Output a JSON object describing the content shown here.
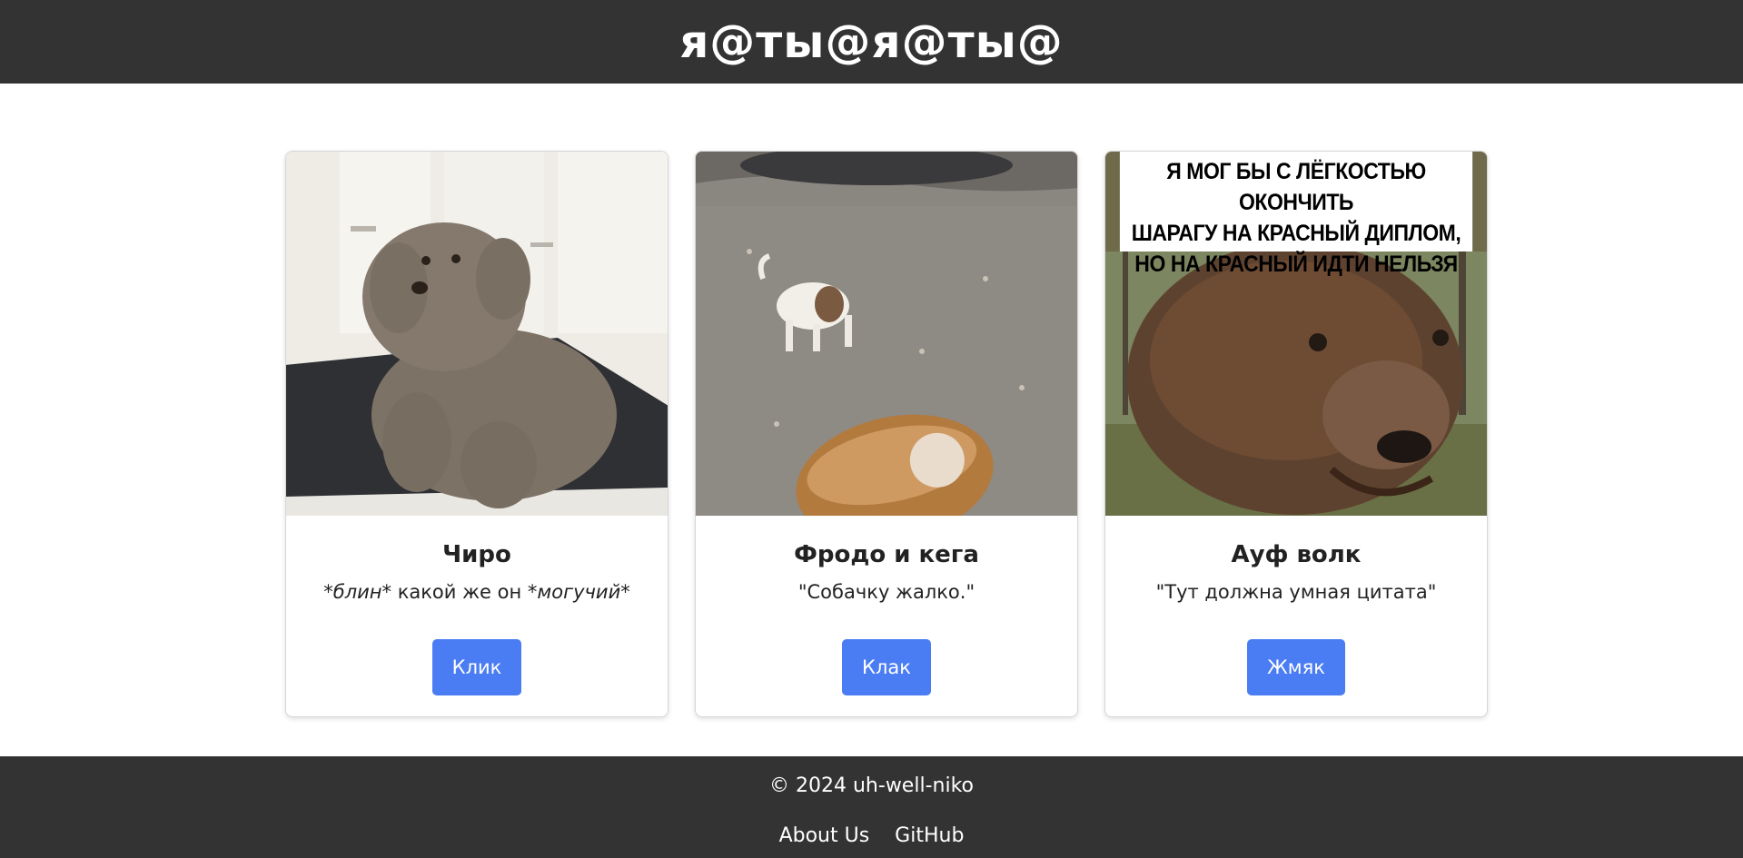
{
  "header": {
    "title": "я@ты@я@ты@"
  },
  "cards": [
    {
      "image_alt": "fluffy-grey-dog-photo",
      "title": "Чиро",
      "text_parts": [
        "*блин*",
        " какой же он ",
        "*могучий*"
      ],
      "button_label": "Клик"
    },
    {
      "image_alt": "dog-and-keg-photo",
      "title": "Фродо и кега",
      "text": "\"Собачку жалко.\"",
      "button_label": "Клак"
    },
    {
      "image_alt": "wolf-meme-photo",
      "image_caption": [
        "Я МОГ БЫ С ЛЁГКОСТЬЮ ОКОНЧИТЬ",
        "ШАРАГУ НА КРАСНЫЙ ДИПЛОМ,",
        "НО НА КРАСНЫЙ ИДТИ НЕЛЬЗЯ"
      ],
      "title": "Ауф волк",
      "text": "\"Тут должна умная цитата\"",
      "button_label": "Жмяк"
    }
  ],
  "footer": {
    "copyright": "© 2024 uh-well-niko",
    "links": [
      "About Us",
      "GitHub"
    ]
  },
  "colors": {
    "header_bg": "#333333",
    "button_bg": "#4a7cf3",
    "footer_bg": "#333333"
  }
}
